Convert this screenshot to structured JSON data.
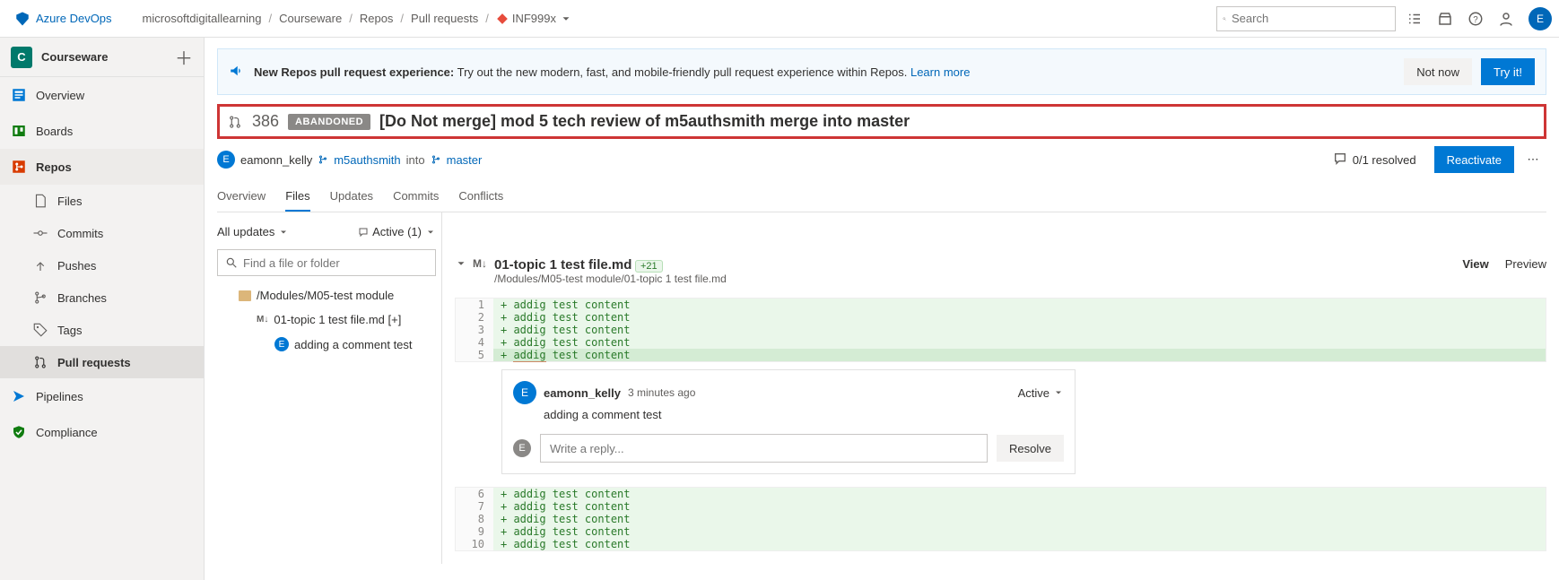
{
  "header": {
    "product": "Azure DevOps",
    "breadcrumbs": [
      "microsoftdigitallearning",
      "Courseware",
      "Repos",
      "Pull requests"
    ],
    "project_ref": "INF999x",
    "search_placeholder": "Search",
    "avatar_initial": "E"
  },
  "sidebar": {
    "project_initial": "C",
    "project_name": "Courseware",
    "items": [
      {
        "label": "Overview"
      },
      {
        "label": "Boards"
      },
      {
        "label": "Repos"
      },
      {
        "label": "Files"
      },
      {
        "label": "Commits"
      },
      {
        "label": "Pushes"
      },
      {
        "label": "Branches"
      },
      {
        "label": "Tags"
      },
      {
        "label": "Pull requests"
      },
      {
        "label": "Pipelines"
      },
      {
        "label": "Compliance"
      }
    ]
  },
  "banner": {
    "bold": "New Repos pull request experience:",
    "text": "Try out the new modern, fast, and mobile-friendly pull request experience within Repos.",
    "learn": "Learn more",
    "not_now": "Not now",
    "try_it": "Try it!"
  },
  "pr": {
    "id": "386",
    "status": "ABANDONED",
    "title": "[Do Not merge] mod 5 tech review of m5authsmith merge into master",
    "author": "eamonn_kelly",
    "author_initial": "E",
    "src_branch": "m5authsmith",
    "into": "into",
    "dst_branch": "master",
    "resolved": "0/1 resolved",
    "reactivate": "Reactivate"
  },
  "tabs": [
    "Overview",
    "Files",
    "Updates",
    "Commits",
    "Conflicts"
  ],
  "filters": {
    "all_updates": "All updates",
    "active": "Active (1)"
  },
  "tree": {
    "search_placeholder": "Find a file or folder",
    "folder": "/Modules/M05-test module",
    "file": "01-topic 1 test file.md [+]",
    "comment": "adding a comment test",
    "comment_initial": "E"
  },
  "file": {
    "name": "01-topic 1 test file.md",
    "diff": "+21",
    "path": "/Modules/M05-test module/01-topic 1 test file.md",
    "view": "View",
    "preview": "Preview"
  },
  "code": {
    "before": [
      {
        "n": "1",
        "t": "+ addig test content"
      },
      {
        "n": "2",
        "t": "+ addig test content"
      },
      {
        "n": "3",
        "t": "+ addig test content"
      },
      {
        "n": "4",
        "t": "+ addig test content"
      },
      {
        "n": "5",
        "t": "+ addig test content",
        "hl": true
      }
    ],
    "after": [
      {
        "n": "6",
        "t": "+ addig test content"
      },
      {
        "n": "7",
        "t": "+ addig test content"
      },
      {
        "n": "8",
        "t": "+ addig test content"
      },
      {
        "n": "9",
        "t": "+ addig test content"
      },
      {
        "n": "10",
        "t": "+ addig test content"
      }
    ]
  },
  "comment": {
    "author": "eamonn_kelly",
    "author_initial": "E",
    "age": "3 minutes ago",
    "body": "adding a comment test",
    "status": "Active",
    "reply_placeholder": "Write a reply...",
    "reply_initial": "E",
    "resolve": "Resolve"
  }
}
